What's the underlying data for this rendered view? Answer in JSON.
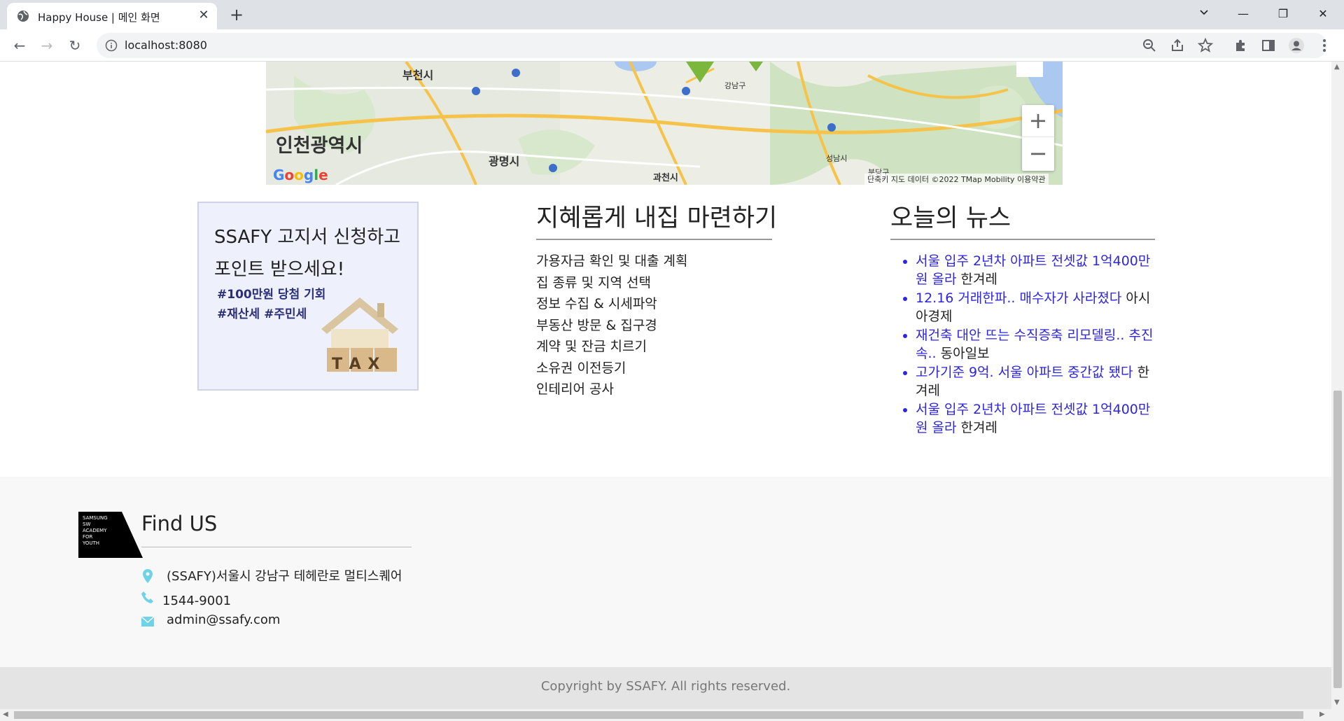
{
  "browser": {
    "tab_title": "Happy House | 메인 화면",
    "new_tab": "+",
    "url": "localhost:8080",
    "minimize": "—",
    "restore": "❐",
    "close": "✕",
    "tab_close": "✕",
    "back": "←",
    "forward": "→",
    "reload": "↻"
  },
  "map": {
    "labels": {
      "incheon": "인천광역시",
      "bucheon": "부천시",
      "gwangmyeong": "광명시",
      "gwacheon": "과천시",
      "seongnam": "성남시",
      "bundang": "분당구",
      "gangnam": "강남구"
    },
    "zoom_in": "+",
    "zoom_out": "−",
    "google": "Google",
    "attribution": "단축키   지도 데이터 ©2022 TMap Mobility   이용약관"
  },
  "ad": {
    "line1": "SSAFY 고지서 신청하고",
    "line2": "포인트 받으세요!",
    "tag1": "#100만원 당첨 기회",
    "tag2": "#재산세 #주민세",
    "tax": "T  A  X"
  },
  "steps": {
    "title": "지혜롭게 내집 마련하기",
    "items": [
      "가용자금 확인 및 대출 계획",
      "집 종류 및 지역 선택",
      "정보 수집 & 시세파악",
      "부동산 방문 & 집구경",
      "계약 및 잔금 치르기",
      "소유권 이전등기",
      "인테리어 공사"
    ]
  },
  "news": {
    "title": "오늘의 뉴스",
    "items": [
      {
        "headline": "서울 입주 2년차 아파트 전셋값 1억400만원 올라",
        "source": "한겨레"
      },
      {
        "headline": "12.16 거래한파.. 매수자가 사라졌다",
        "source": "아시아경제"
      },
      {
        "headline": "재건축 대안 뜨는 수직증축 리모델링.. 추진 속..",
        "source": "동아일보"
      },
      {
        "headline": "고가기준 9억. 서울 아파트 중간값 됐다",
        "source": "한겨레"
      },
      {
        "headline": "서울 입주 2년차 아파트 전셋값 1억400만원 올라",
        "source": "한겨레"
      }
    ]
  },
  "footer": {
    "logo_text": "SAMSUNG SW ACADEMY FOR YOUTH",
    "title": "Find US",
    "address": "(SSAFY)서울시 강남구 테헤란로 멀티스퀘어",
    "phone": "1544-9001",
    "email": "admin@ssafy.com",
    "copyright": "Copyright by SSAFY. All rights reserved."
  },
  "colors": {
    "link": "#2d25e0",
    "accent_icon": "#6ed3e6",
    "footer_bg": "#f8f8f8",
    "copyright_bg": "#e4e4e4"
  }
}
